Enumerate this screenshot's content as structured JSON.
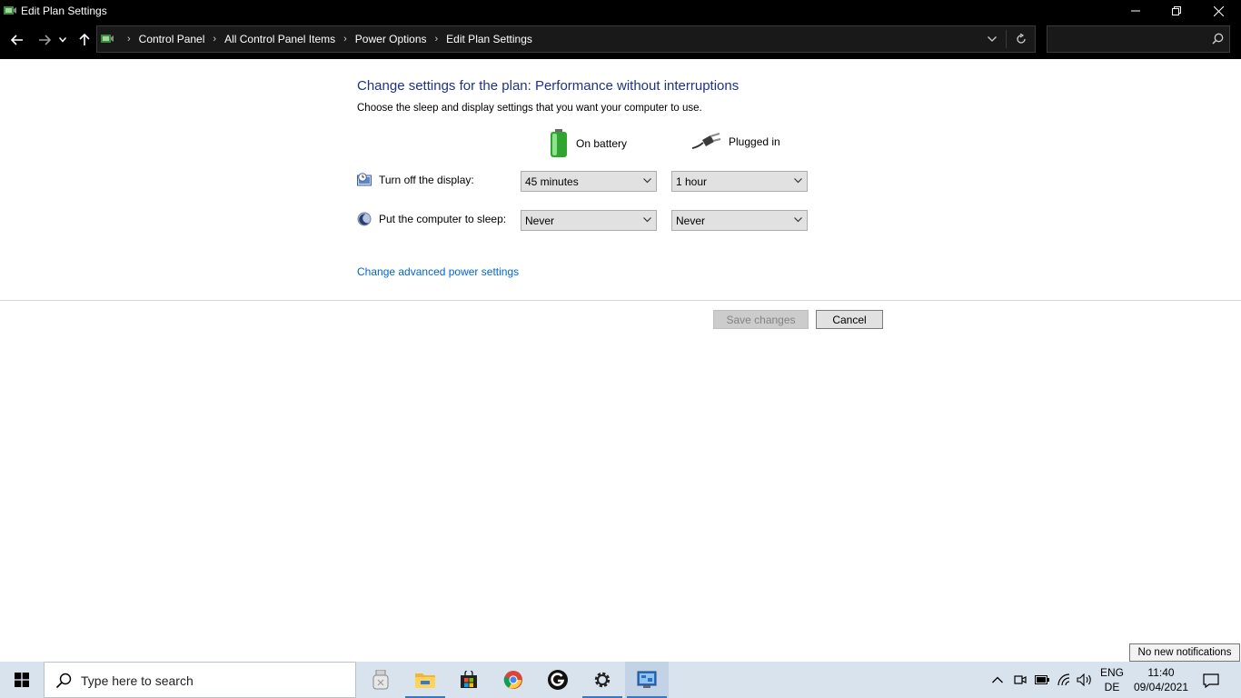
{
  "window": {
    "title": "Edit Plan Settings"
  },
  "breadcrumb": [
    "Control Panel",
    "All Control Panel Items",
    "Power Options",
    "Edit Plan Settings"
  ],
  "search": {
    "placeholder": ""
  },
  "content": {
    "heading": "Change settings for the plan: Performance without interruptions",
    "subheading": "Choose the sleep and display settings that you want your computer to use.",
    "columns": {
      "battery": "On battery",
      "plugged": "Plugged in"
    },
    "rows": [
      {
        "label": "Turn off the display:",
        "battery": "45 minutes",
        "plugged": "1 hour"
      },
      {
        "label": "Put the computer to sleep:",
        "battery": "Never",
        "plugged": "Never"
      }
    ],
    "advanced_link": "Change advanced power settings",
    "save_label": "Save changes",
    "cancel_label": "Cancel"
  },
  "tooltip": "No new notifications",
  "taskbar": {
    "search_placeholder": "Type here to search",
    "apps": [
      "usb-drive-icon",
      "file-explorer-icon",
      "store-icon",
      "chrome-icon",
      "g-app-icon",
      "settings-icon",
      "control-panel-icon"
    ],
    "language_top": "ENG",
    "language_bottom": "DE",
    "time": "11:40",
    "date": "09/04/2021"
  },
  "colors": {
    "heading": "#1e3287",
    "link": "#0066cc",
    "chrome_bg": "#000000",
    "taskbar_bg": "#d9e3ee"
  }
}
